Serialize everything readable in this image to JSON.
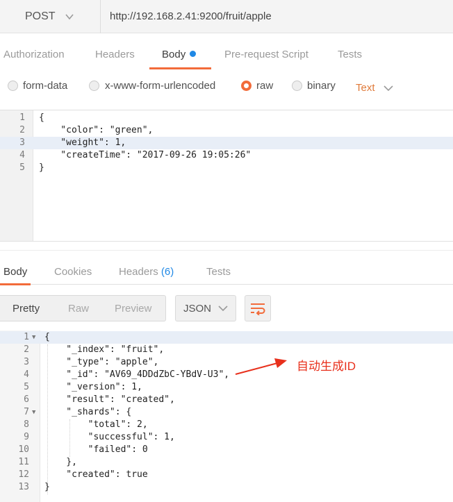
{
  "request": {
    "method": "POST",
    "url": "http://192.168.2.41:9200/fruit/apple"
  },
  "request_tabs": [
    "Authorization",
    "Headers",
    "Body",
    "Pre-request Script",
    "Tests"
  ],
  "body_types": [
    "form-data",
    "x-www-form-urlencoded",
    "raw",
    "binary"
  ],
  "content_type": "Text",
  "request_body": {
    "line_numbers": [
      "1",
      "2",
      "3",
      "4",
      "5"
    ],
    "lines": [
      "{",
      "    \"color\": \"green\",",
      "    \"weight\": 1,",
      "    \"createTime\": \"2017-09-26 19:05:26\"",
      "}"
    ]
  },
  "response_tabs": {
    "body": "Body",
    "cookies": "Cookies",
    "headers": "Headers",
    "headers_count": "(6)",
    "tests": "Tests"
  },
  "view_modes": [
    "Pretty",
    "Raw",
    "Preview"
  ],
  "format": "JSON",
  "response_body": {
    "line_numbers": [
      "1",
      "2",
      "3",
      "4",
      "5",
      "6",
      "7",
      "8",
      "9",
      "10",
      "11",
      "12",
      "13"
    ],
    "lines": [
      "{",
      "    \"_index\": \"fruit\",",
      "    \"_type\": \"apple\",",
      "    \"_id\": \"AV69_4DDdZbC-YBdV-U3\",",
      "    \"_version\": 1,",
      "    \"result\": \"created\",",
      "    \"_shards\": {",
      "        \"total\": 2,",
      "        \"successful\": 1,",
      "        \"failed\": 0",
      "    },",
      "    \"created\": true",
      "}"
    ]
  },
  "annotation": "自动生成ID",
  "colors": {
    "accent": "#f26b3a",
    "annotation": "#e8301c",
    "dot": "#1f88e5"
  }
}
